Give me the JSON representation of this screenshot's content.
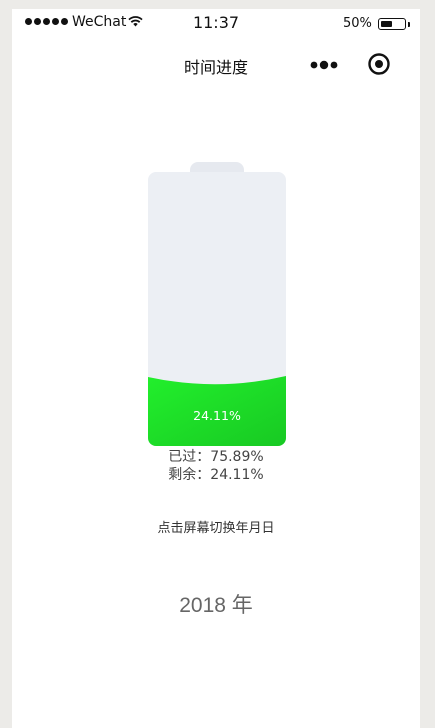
{
  "status_bar": {
    "carrier": "WeChat",
    "time": "11:37",
    "battery_percent_text": "50%",
    "battery_level": 0.5,
    "signal_icon": "signal-dots-icon",
    "wifi_icon": "wifi-icon"
  },
  "nav": {
    "title": "时间进度",
    "more_icon": "more-dots-icon",
    "close_icon": "target-circle-icon"
  },
  "progress": {
    "fill_label": "24.11%",
    "remaining_fraction": 0.2411,
    "passed_line": "已过：75.89%",
    "remaining_line": "剩余：24.11%"
  },
  "toggle_hint": "点击屏幕切换年月日",
  "period": {
    "display": "2018 年"
  },
  "colors": {
    "battery_empty": "#eceff4",
    "battery_cap": "#e6e9ef",
    "fill_start": "#22ef2c",
    "fill_end": "#18c923",
    "page_bg": "#ecebe8"
  }
}
